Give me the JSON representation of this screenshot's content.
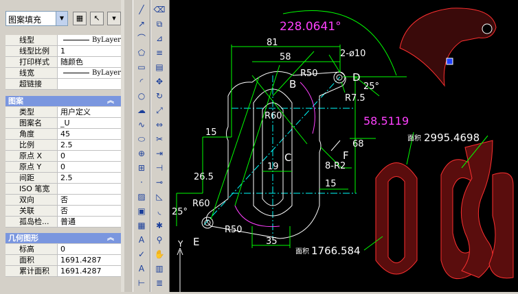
{
  "header": {
    "object_type": "图案填充"
  },
  "general_props": [
    {
      "key": "线型",
      "value": "ByLayer",
      "line": true
    },
    {
      "key": "线型比例",
      "value": "1"
    },
    {
      "key": "打印样式",
      "value": "随颜色"
    },
    {
      "key": "线宽",
      "value": "ByLayer",
      "line": true
    },
    {
      "key": "超链接",
      "value": ""
    }
  ],
  "pattern_section": {
    "title": "图案",
    "rows": [
      {
        "key": "类型",
        "value": "用户定义"
      },
      {
        "key": "图案名",
        "value": "_U"
      },
      {
        "key": "角度",
        "value": "45"
      },
      {
        "key": "比例",
        "value": "2.5"
      },
      {
        "key": "原点 X",
        "value": "0"
      },
      {
        "key": "原点 Y",
        "value": "0"
      },
      {
        "key": "间距",
        "value": "2.5"
      },
      {
        "key": "ISO 笔宽",
        "value": ""
      },
      {
        "key": "双向",
        "value": "否"
      },
      {
        "key": "关联",
        "value": "否"
      },
      {
        "key": "孤岛检...",
        "value": "普通"
      }
    ]
  },
  "geometry_section": {
    "title": "几何图形",
    "rows": [
      {
        "key": "标高",
        "value": "0"
      },
      {
        "key": "面积",
        "value": "1691.4287"
      },
      {
        "key": "累计面积",
        "value": "1691.4287"
      }
    ]
  },
  "drawing": {
    "dims": {
      "angle_top": "228.0641°",
      "d81": "81",
      "d58": "58",
      "hole": "2-ø10",
      "r50_top": "R50",
      "r7_5": "R7.5",
      "a25_right": "25°",
      "d58_5": "58.5119",
      "d68": "68",
      "d15_left": "15",
      "r60_mid": "R60",
      "d26_5": "26.5",
      "d19": "19",
      "r2": "8-R2",
      "d15_right": "15",
      "a25_left": "25°",
      "r60_low": "R60",
      "r50_low": "R50",
      "d35": "35",
      "area_top_label": "面积",
      "area_top": "2995.4698",
      "area_bottom_label": "面积",
      "area_bottom": "1766.584"
    },
    "letters": {
      "b": "B",
      "c": "C",
      "d": "D",
      "e": "E",
      "f": "F"
    },
    "ucs_y": "Y"
  },
  "colors": {
    "green": "#00ff00",
    "yellow": "#ffff00",
    "magenta": "#ff40ff",
    "cyan": "#00ffff",
    "white": "#ffffff",
    "red_hatch": "#ff3030"
  }
}
